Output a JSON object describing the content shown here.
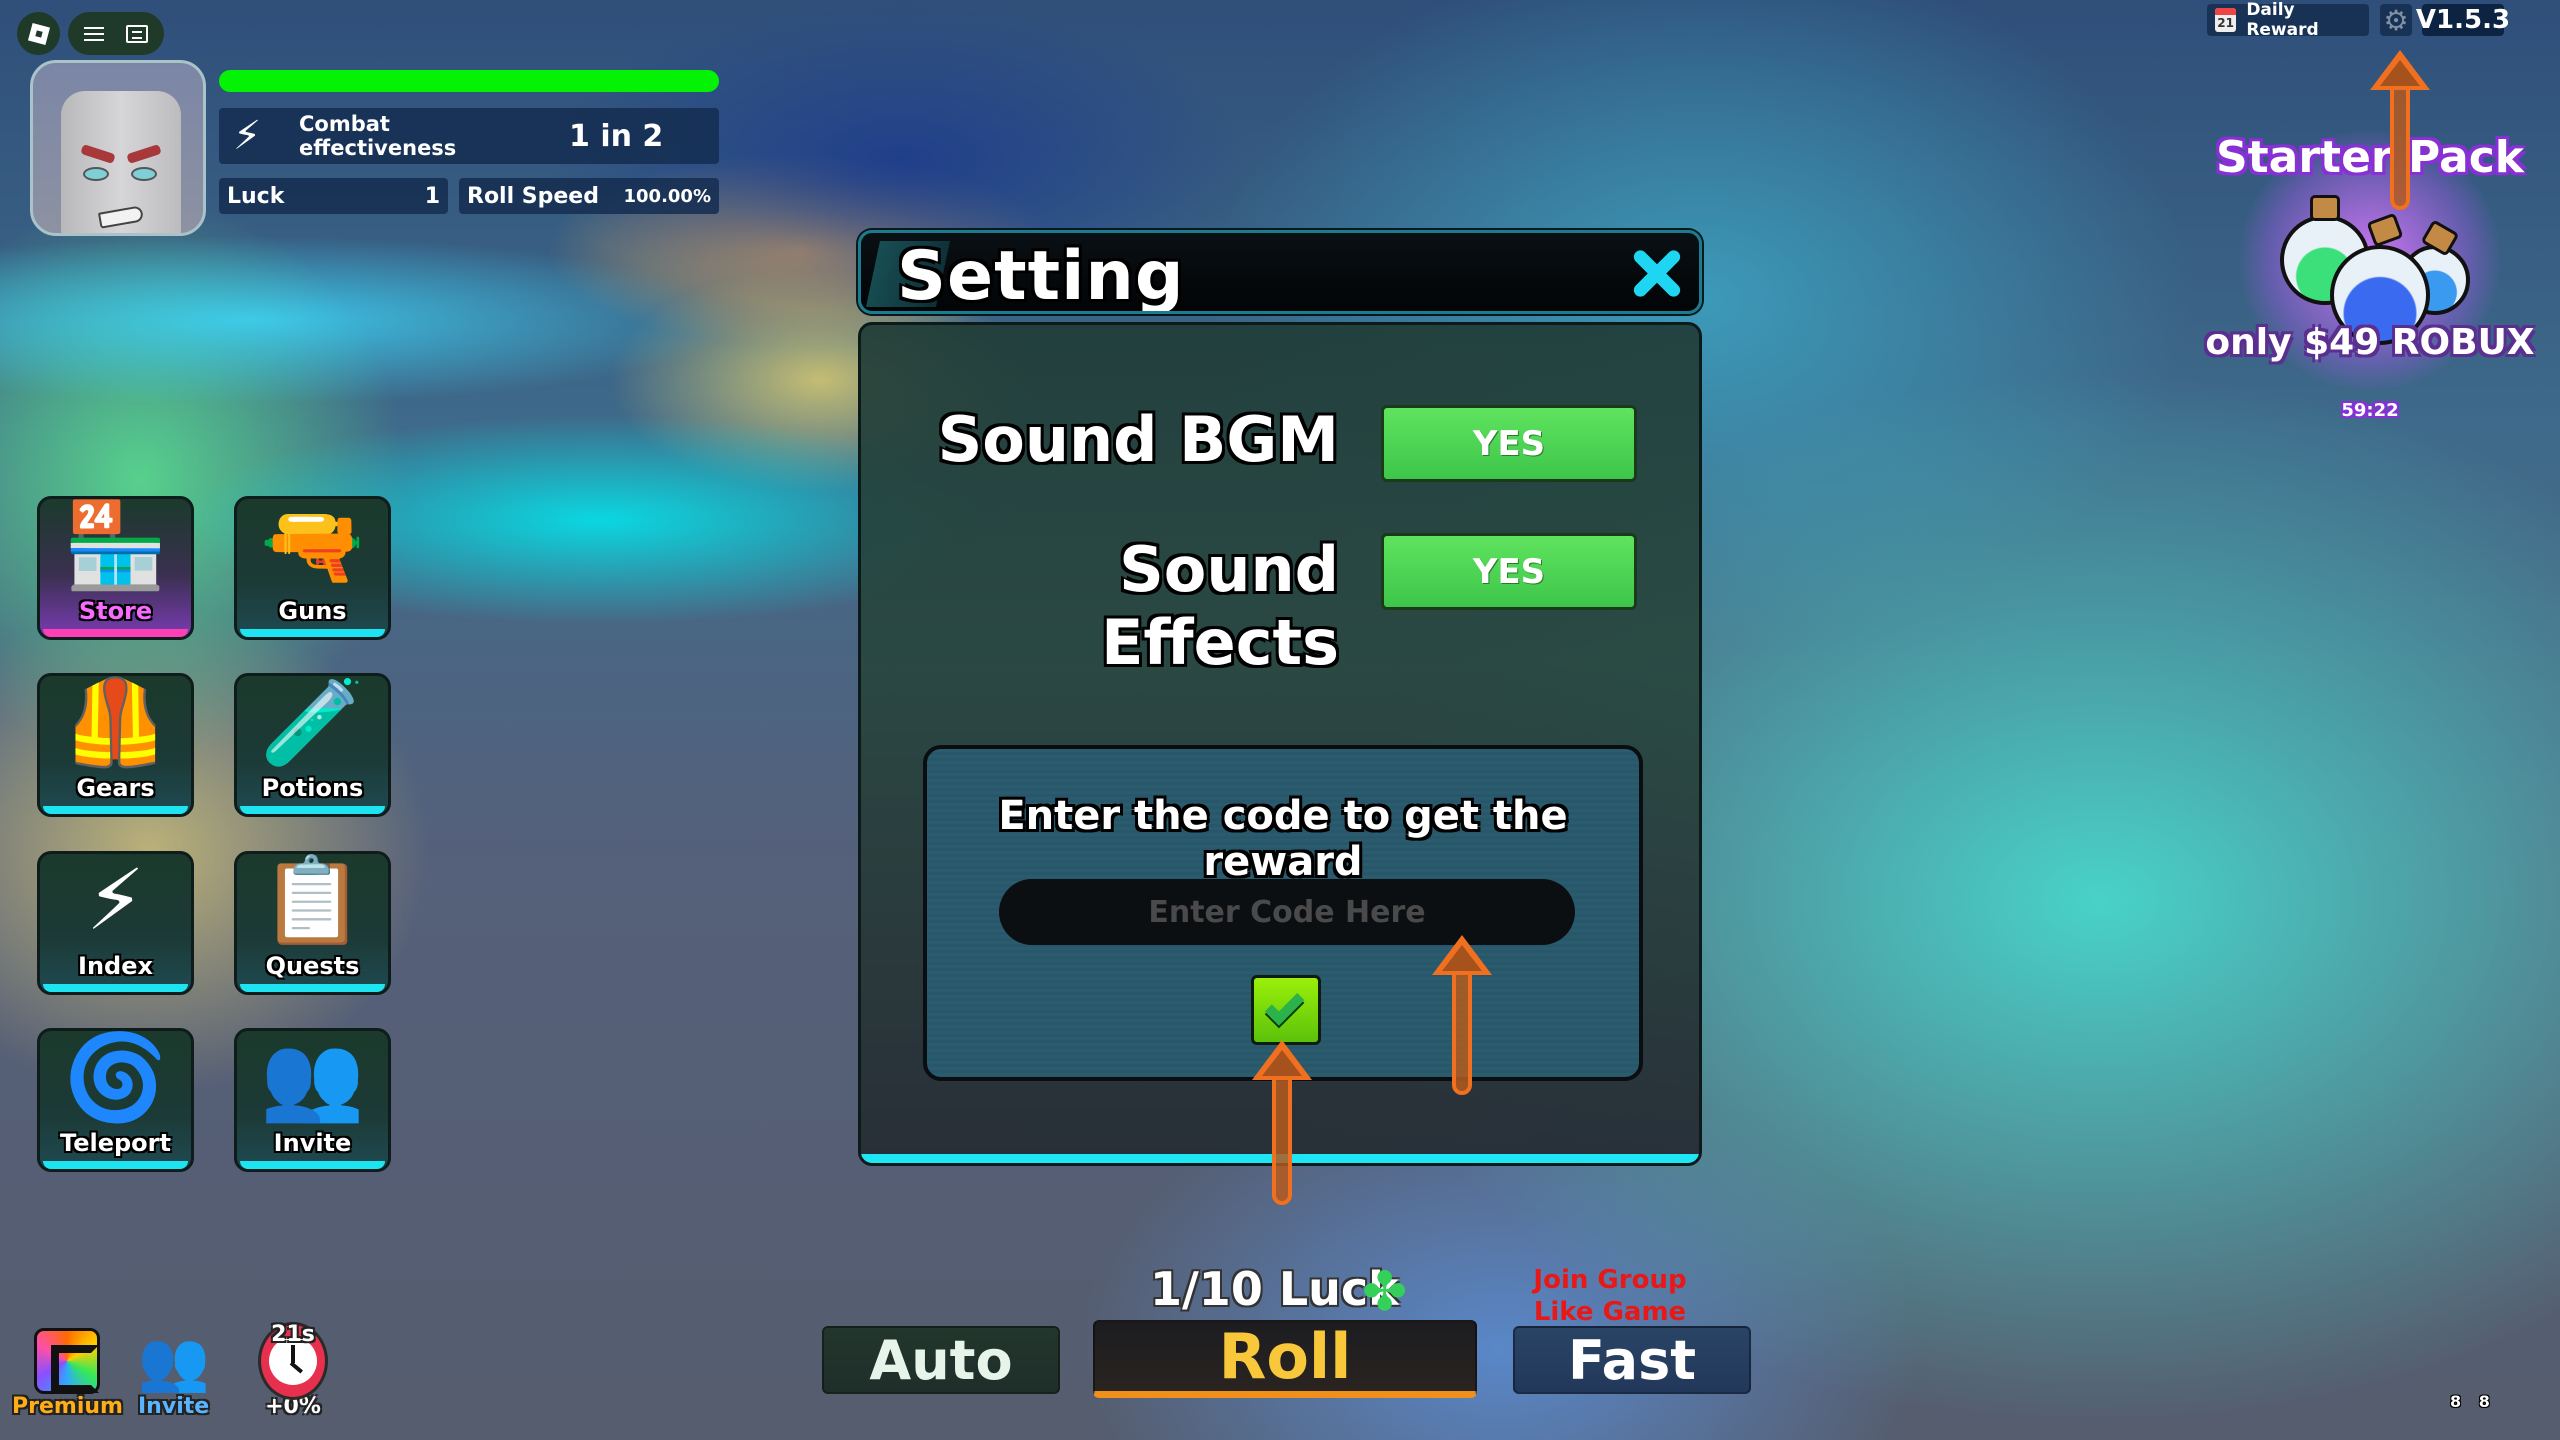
{
  "roblox": {
    "logo_icon": "roblox-logo-icon",
    "menu_icon": "hamburger-menu-icon",
    "chat_icon": "chat-icon"
  },
  "player": {
    "avatar_icon": "player-avatar",
    "health_fraction": 1.0,
    "health_color": "#04f204",
    "combat": {
      "icon": "lightning-burst-icon",
      "label": "Combat effectiveness",
      "value": "1 in 2"
    },
    "luck": {
      "label": "Luck",
      "value": "1"
    },
    "roll_speed": {
      "label": "Roll Speed",
      "value": "100.00%"
    }
  },
  "side_menu": {
    "items": [
      {
        "label": "Store",
        "icon": "store-icon",
        "glyph": "🏪"
      },
      {
        "label": "Guns",
        "icon": "pistol-icon",
        "glyph": "🔫"
      },
      {
        "label": "Gears",
        "icon": "vest-icon",
        "glyph": "🦺"
      },
      {
        "label": "Potions",
        "icon": "potion-icon",
        "glyph": "🧪"
      },
      {
        "label": "Index",
        "icon": "index-window-icon",
        "glyph": "⚡"
      },
      {
        "label": "Quests",
        "icon": "clipboard-icon",
        "glyph": "📋"
      },
      {
        "label": "Teleport",
        "icon": "portal-icon",
        "glyph": "🌀"
      },
      {
        "label": "Invite",
        "icon": "friends-icon",
        "glyph": "👥"
      }
    ]
  },
  "bottom_left": {
    "premium": {
      "label": "Premium",
      "icon": "premium-icon"
    },
    "invite": {
      "label": "Invite",
      "icon": "friends-icon",
      "glyph": "👥"
    },
    "boost": {
      "timer": "21s",
      "value": "+0%",
      "icon": "clock-icon"
    }
  },
  "top_right": {
    "daily_reward": {
      "label": "Daily Reward",
      "calendar_month": "MAR",
      "calendar_day": "21"
    },
    "settings_icon": "gear-icon",
    "version": "V1.5.3"
  },
  "starter_pack": {
    "title": "Starter Pack",
    "price": "only $49 ROBUX",
    "timer": "59:22"
  },
  "setting_dialog": {
    "title": "Setting",
    "options": [
      {
        "label": "Sound BGM",
        "value": "YES"
      },
      {
        "label": "Sound Effects",
        "value": "YES"
      }
    ],
    "code": {
      "title": "Enter the code to get the reward",
      "placeholder": "Enter Code Here",
      "value": ""
    }
  },
  "roll_bar": {
    "luck_label": "1/10 Luck",
    "luck_icon": "clover-icon",
    "join_label_line1": "Join Group",
    "join_label_line2": "Like Game",
    "auto": "Auto",
    "roll": "Roll",
    "fast": "Fast"
  },
  "fps_readout": "8 8"
}
